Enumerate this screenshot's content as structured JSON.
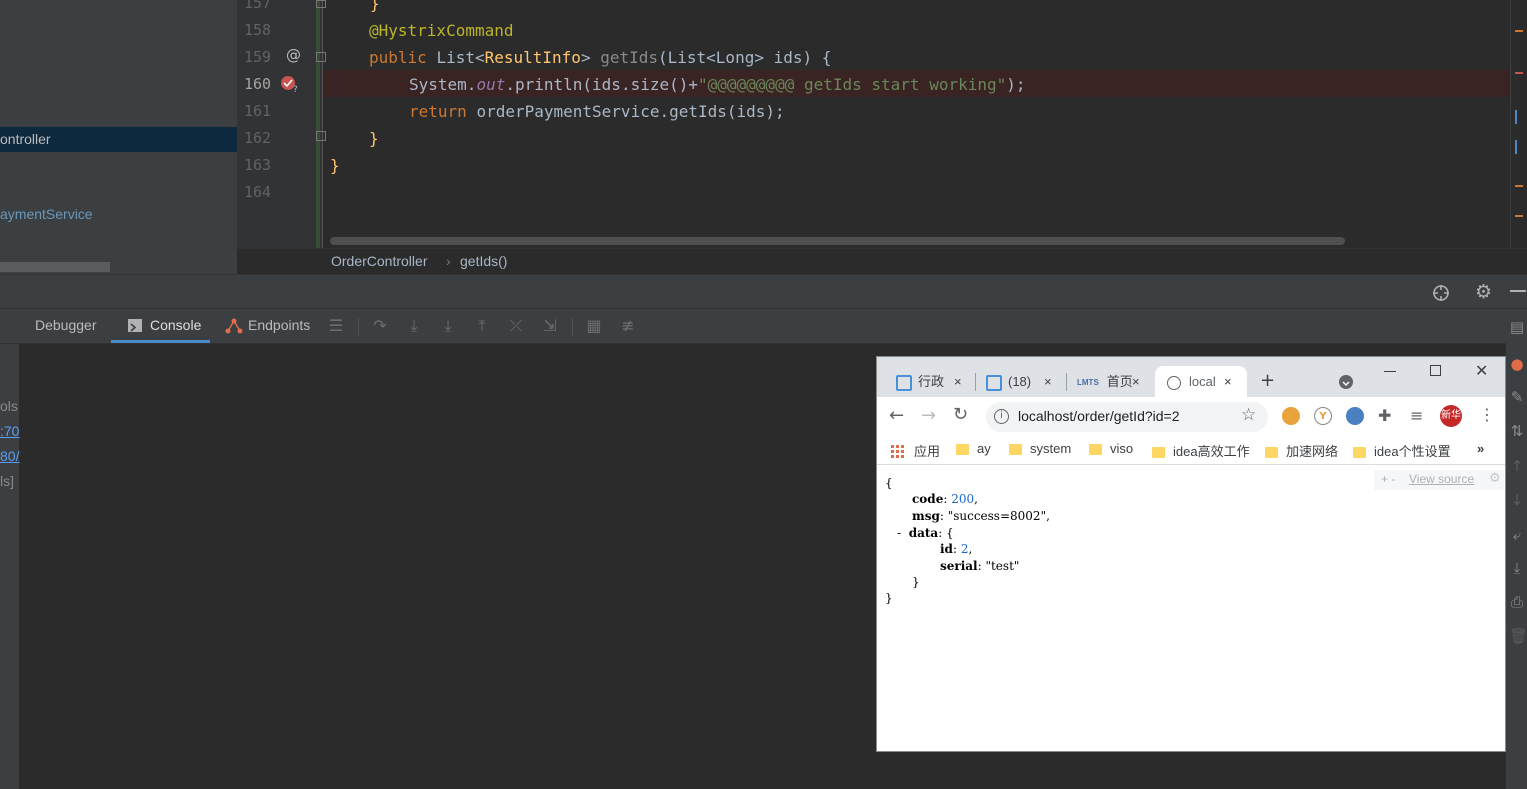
{
  "project": {
    "items": [
      "ontroller",
      "aymentService"
    ]
  },
  "editor": {
    "line_numbers": [
      "157",
      "158",
      "159",
      "160",
      "161",
      "162",
      "163",
      "164"
    ],
    "line_158": "@HystrixCommand",
    "line_159_kw": "public ",
    "line_159_a": "List<",
    "line_159_b": "ResultInfo",
    "line_159_c": "> ",
    "line_159_fn": "getIds",
    "line_159_d": "(List<Long> ids) {",
    "line_160_a": "System.",
    "line_160_out": "out",
    "line_160_b": ".println(ids.size()+",
    "line_160_str": "\"@@@@@@@@@ getIds start working\"",
    "line_160_c": ");",
    "line_161_kw": "return ",
    "line_161_rest": "orderPaymentService.getIds(ids);",
    "line_162": "}",
    "line_163": "}",
    "gutter_at": "@"
  },
  "breadcrumb": {
    "class": "OrderController",
    "sep": "›",
    "method": "getIds()"
  },
  "debug": {
    "tabs": [
      "Debugger",
      "Console",
      "Endpoints"
    ],
    "left_fragments": [
      "ols",
      ":70",
      "80/",
      "ls]"
    ]
  },
  "browser": {
    "tabs": [
      {
        "title": "行政",
        "close": "×"
      },
      {
        "title": "(18)",
        "close": "×"
      },
      {
        "title": "首页",
        "close": "×"
      },
      {
        "title": "local",
        "close": "×"
      }
    ],
    "new_tab": "+",
    "url": "localhost/order/getId?id=2",
    "bookmarks": [
      "应用",
      "ay",
      "system",
      "viso",
      "idea高效工作",
      "加速网络",
      "idea个性设置"
    ],
    "more_bookmarks": "»",
    "view_source": "View source",
    "view_source_controls": "+ -",
    "json_lines": {
      "open": "{",
      "code_key": "code",
      "code_val": "200",
      "msg_key": "msg",
      "msg_val": "\"success=8002\"",
      "data_toggle": "-",
      "data_key": "data",
      "id_key": "id",
      "id_val": "2",
      "serial_key": "serial",
      "serial_val": "\"test\"",
      "inner_close": "}",
      "close": "}"
    },
    "ext_label": "新华"
  }
}
